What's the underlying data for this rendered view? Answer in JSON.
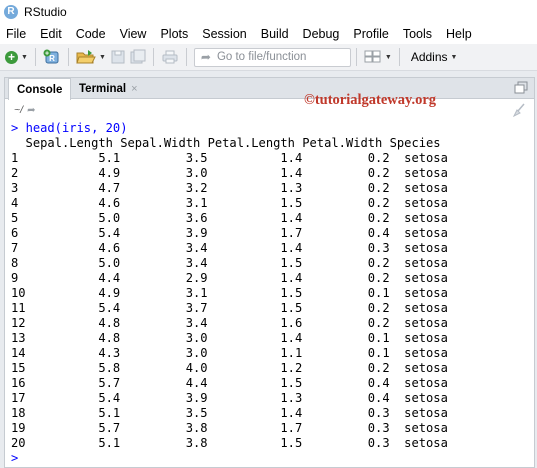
{
  "window": {
    "title": "RStudio",
    "icon": "R"
  },
  "menu": [
    "File",
    "Edit",
    "Code",
    "View",
    "Plots",
    "Session",
    "Build",
    "Debug",
    "Profile",
    "Tools",
    "Help"
  ],
  "toolbar": {
    "goto_placeholder": "Go to file/function",
    "addins_label": "Addins"
  },
  "tabs": {
    "console": "Console",
    "terminal": "Terminal",
    "close_glyph": "×"
  },
  "pane": {
    "cwd": "~/",
    "watermark": "©tutorialgateway.org"
  },
  "console": {
    "prompt": ">",
    "command": "head(iris, 20)",
    "header": "  Sepal.Length Sepal.Width Petal.Length Petal.Width Species",
    "rows": [
      "1           5.1         3.5          1.4         0.2  setosa",
      "2           4.9         3.0          1.4         0.2  setosa",
      "3           4.7         3.2          1.3         0.2  setosa",
      "4           4.6         3.1          1.5         0.2  setosa",
      "5           5.0         3.6          1.4         0.2  setosa",
      "6           5.4         3.9          1.7         0.4  setosa",
      "7           4.6         3.4          1.4         0.3  setosa",
      "8           5.0         3.4          1.5         0.2  setosa",
      "9           4.4         2.9          1.4         0.2  setosa",
      "10          4.9         3.1          1.5         0.1  setosa",
      "11          5.4         3.7          1.5         0.2  setosa",
      "12          4.8         3.4          1.6         0.2  setosa",
      "13          4.8         3.0          1.4         0.1  setosa",
      "14          4.3         3.0          1.1         0.1  setosa",
      "15          5.8         4.0          1.2         0.2  setosa",
      "16          5.7         4.4          1.5         0.4  setosa",
      "17          5.4         3.9          1.3         0.4  setosa",
      "18          5.1         3.5          1.4         0.3  setosa",
      "19          5.7         3.8          1.7         0.3  setosa",
      "20          5.1         3.8          1.5         0.3  setosa"
    ]
  },
  "colors": {
    "prompt": "#0000ff",
    "watermark": "#c0392b",
    "r_logo": "#75aadb"
  }
}
